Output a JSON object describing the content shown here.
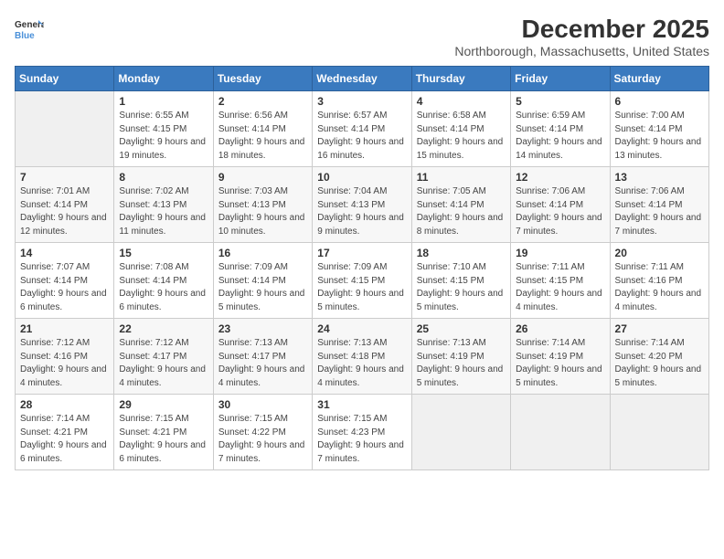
{
  "header": {
    "logo_general": "General",
    "logo_blue": "Blue",
    "month_title": "December 2025",
    "location": "Northborough, Massachusetts, United States"
  },
  "days_of_week": [
    "Sunday",
    "Monday",
    "Tuesday",
    "Wednesday",
    "Thursday",
    "Friday",
    "Saturday"
  ],
  "weeks": [
    [
      {
        "day": "",
        "sunrise": "",
        "sunset": "",
        "daylight": "",
        "empty": true
      },
      {
        "day": "1",
        "sunrise": "Sunrise: 6:55 AM",
        "sunset": "Sunset: 4:15 PM",
        "daylight": "Daylight: 9 hours and 19 minutes."
      },
      {
        "day": "2",
        "sunrise": "Sunrise: 6:56 AM",
        "sunset": "Sunset: 4:14 PM",
        "daylight": "Daylight: 9 hours and 18 minutes."
      },
      {
        "day": "3",
        "sunrise": "Sunrise: 6:57 AM",
        "sunset": "Sunset: 4:14 PM",
        "daylight": "Daylight: 9 hours and 16 minutes."
      },
      {
        "day": "4",
        "sunrise": "Sunrise: 6:58 AM",
        "sunset": "Sunset: 4:14 PM",
        "daylight": "Daylight: 9 hours and 15 minutes."
      },
      {
        "day": "5",
        "sunrise": "Sunrise: 6:59 AM",
        "sunset": "Sunset: 4:14 PM",
        "daylight": "Daylight: 9 hours and 14 minutes."
      },
      {
        "day": "6",
        "sunrise": "Sunrise: 7:00 AM",
        "sunset": "Sunset: 4:14 PM",
        "daylight": "Daylight: 9 hours and 13 minutes."
      }
    ],
    [
      {
        "day": "7",
        "sunrise": "Sunrise: 7:01 AM",
        "sunset": "Sunset: 4:14 PM",
        "daylight": "Daylight: 9 hours and 12 minutes."
      },
      {
        "day": "8",
        "sunrise": "Sunrise: 7:02 AM",
        "sunset": "Sunset: 4:13 PM",
        "daylight": "Daylight: 9 hours and 11 minutes."
      },
      {
        "day": "9",
        "sunrise": "Sunrise: 7:03 AM",
        "sunset": "Sunset: 4:13 PM",
        "daylight": "Daylight: 9 hours and 10 minutes."
      },
      {
        "day": "10",
        "sunrise": "Sunrise: 7:04 AM",
        "sunset": "Sunset: 4:13 PM",
        "daylight": "Daylight: 9 hours and 9 minutes."
      },
      {
        "day": "11",
        "sunrise": "Sunrise: 7:05 AM",
        "sunset": "Sunset: 4:14 PM",
        "daylight": "Daylight: 9 hours and 8 minutes."
      },
      {
        "day": "12",
        "sunrise": "Sunrise: 7:06 AM",
        "sunset": "Sunset: 4:14 PM",
        "daylight": "Daylight: 9 hours and 7 minutes."
      },
      {
        "day": "13",
        "sunrise": "Sunrise: 7:06 AM",
        "sunset": "Sunset: 4:14 PM",
        "daylight": "Daylight: 9 hours and 7 minutes."
      }
    ],
    [
      {
        "day": "14",
        "sunrise": "Sunrise: 7:07 AM",
        "sunset": "Sunset: 4:14 PM",
        "daylight": "Daylight: 9 hours and 6 minutes."
      },
      {
        "day": "15",
        "sunrise": "Sunrise: 7:08 AM",
        "sunset": "Sunset: 4:14 PM",
        "daylight": "Daylight: 9 hours and 6 minutes."
      },
      {
        "day": "16",
        "sunrise": "Sunrise: 7:09 AM",
        "sunset": "Sunset: 4:14 PM",
        "daylight": "Daylight: 9 hours and 5 minutes."
      },
      {
        "day": "17",
        "sunrise": "Sunrise: 7:09 AM",
        "sunset": "Sunset: 4:15 PM",
        "daylight": "Daylight: 9 hours and 5 minutes."
      },
      {
        "day": "18",
        "sunrise": "Sunrise: 7:10 AM",
        "sunset": "Sunset: 4:15 PM",
        "daylight": "Daylight: 9 hours and 5 minutes."
      },
      {
        "day": "19",
        "sunrise": "Sunrise: 7:11 AM",
        "sunset": "Sunset: 4:15 PM",
        "daylight": "Daylight: 9 hours and 4 minutes."
      },
      {
        "day": "20",
        "sunrise": "Sunrise: 7:11 AM",
        "sunset": "Sunset: 4:16 PM",
        "daylight": "Daylight: 9 hours and 4 minutes."
      }
    ],
    [
      {
        "day": "21",
        "sunrise": "Sunrise: 7:12 AM",
        "sunset": "Sunset: 4:16 PM",
        "daylight": "Daylight: 9 hours and 4 minutes."
      },
      {
        "day": "22",
        "sunrise": "Sunrise: 7:12 AM",
        "sunset": "Sunset: 4:17 PM",
        "daylight": "Daylight: 9 hours and 4 minutes."
      },
      {
        "day": "23",
        "sunrise": "Sunrise: 7:13 AM",
        "sunset": "Sunset: 4:17 PM",
        "daylight": "Daylight: 9 hours and 4 minutes."
      },
      {
        "day": "24",
        "sunrise": "Sunrise: 7:13 AM",
        "sunset": "Sunset: 4:18 PM",
        "daylight": "Daylight: 9 hours and 4 minutes."
      },
      {
        "day": "25",
        "sunrise": "Sunrise: 7:13 AM",
        "sunset": "Sunset: 4:19 PM",
        "daylight": "Daylight: 9 hours and 5 minutes."
      },
      {
        "day": "26",
        "sunrise": "Sunrise: 7:14 AM",
        "sunset": "Sunset: 4:19 PM",
        "daylight": "Daylight: 9 hours and 5 minutes."
      },
      {
        "day": "27",
        "sunrise": "Sunrise: 7:14 AM",
        "sunset": "Sunset: 4:20 PM",
        "daylight": "Daylight: 9 hours and 5 minutes."
      }
    ],
    [
      {
        "day": "28",
        "sunrise": "Sunrise: 7:14 AM",
        "sunset": "Sunset: 4:21 PM",
        "daylight": "Daylight: 9 hours and 6 minutes."
      },
      {
        "day": "29",
        "sunrise": "Sunrise: 7:15 AM",
        "sunset": "Sunset: 4:21 PM",
        "daylight": "Daylight: 9 hours and 6 minutes."
      },
      {
        "day": "30",
        "sunrise": "Sunrise: 7:15 AM",
        "sunset": "Sunset: 4:22 PM",
        "daylight": "Daylight: 9 hours and 7 minutes."
      },
      {
        "day": "31",
        "sunrise": "Sunrise: 7:15 AM",
        "sunset": "Sunset: 4:23 PM",
        "daylight": "Daylight: 9 hours and 7 minutes."
      },
      {
        "day": "",
        "sunrise": "",
        "sunset": "",
        "daylight": "",
        "empty": true
      },
      {
        "day": "",
        "sunrise": "",
        "sunset": "",
        "daylight": "",
        "empty": true
      },
      {
        "day": "",
        "sunrise": "",
        "sunset": "",
        "daylight": "",
        "empty": true
      }
    ]
  ]
}
